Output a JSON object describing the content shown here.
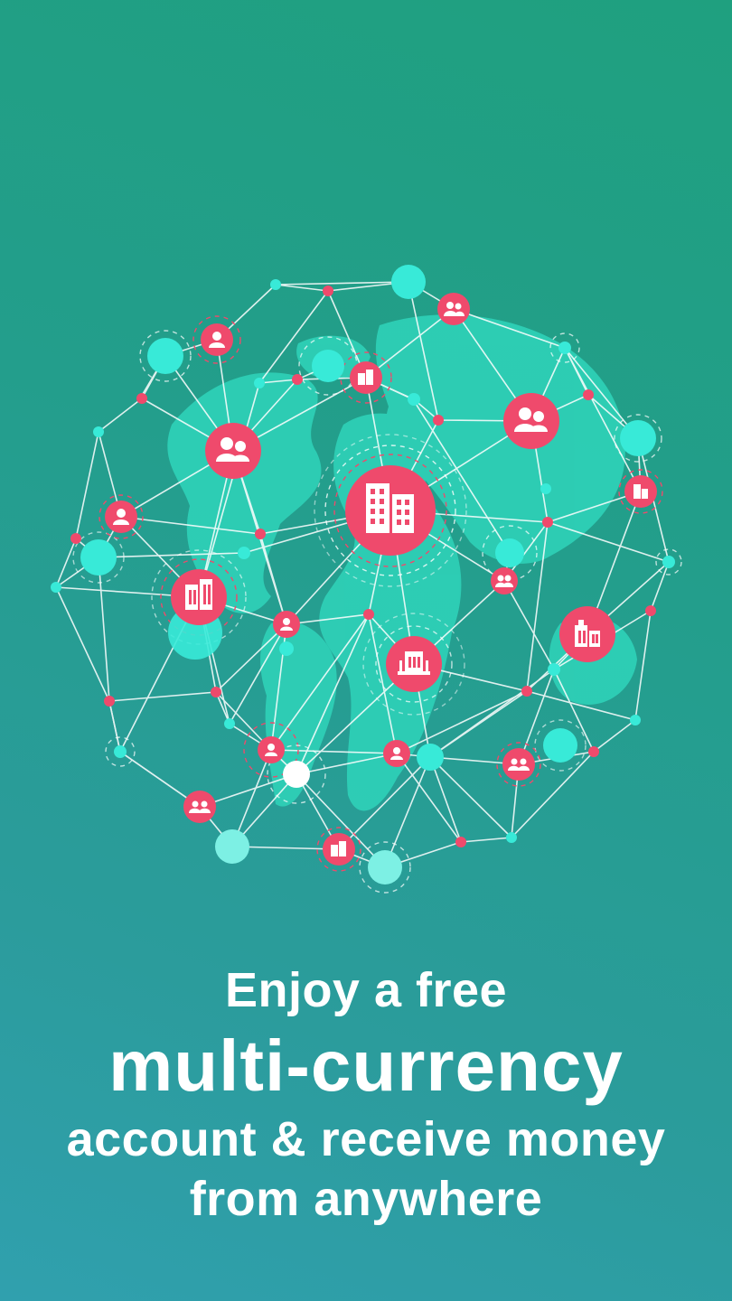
{
  "headline": {
    "line1": "Enjoy a free",
    "line2": "multi-currency",
    "line3": "account & receive money",
    "line4": "from anywhere"
  },
  "illustration": {
    "name": "network-globe-illustration",
    "icons": [
      "user-icon",
      "users-icon",
      "building-icon",
      "bank-icon"
    ],
    "colors": {
      "ocean": "#1fa07f",
      "land": "#2dd3b9",
      "node_cyan": "#35ead9",
      "node_pink": "#ef4a6c",
      "line": "#ffffff"
    }
  }
}
